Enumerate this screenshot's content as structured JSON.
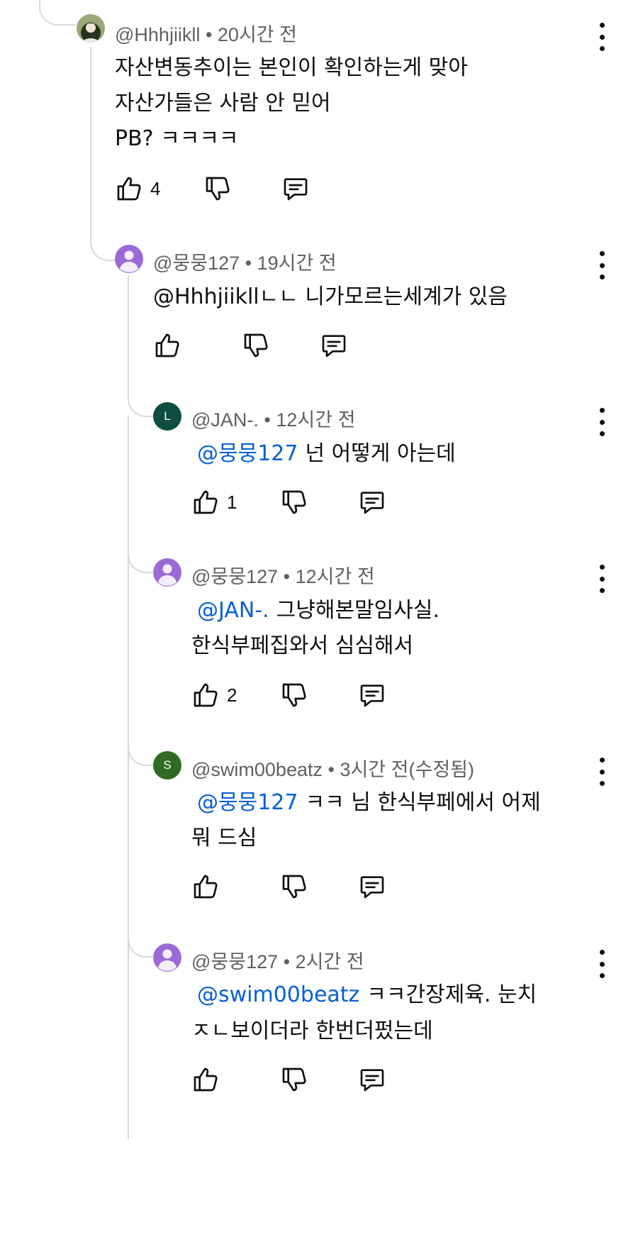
{
  "comments": [
    {
      "author": "@Hhhjiikll",
      "time": "20시간 전",
      "lines": [
        {
          "text": "자산변동추이는 본인이 확인하는게 맞아"
        },
        {
          "text": "자산가들은 사람 안 믿어"
        },
        {
          "text": "PB? ㅋㅋㅋㅋ"
        }
      ],
      "likes": "4",
      "avatar": {
        "type": "photo"
      }
    },
    {
      "author": "@뭉뭉127",
      "time": "19시간 전",
      "lines": [
        {
          "text": "@Hhhjiikllㄴㄴ 니가모르는세계가 있음"
        }
      ],
      "likes": "",
      "avatar": {
        "type": "default",
        "color": "#9c6ad6"
      }
    },
    {
      "author": "@JAN-.",
      "time": "12시간 전",
      "lines": [
        {
          "mention": "@뭉뭉127",
          "text": "넌 어떻게 아는데"
        }
      ],
      "likes": "1",
      "avatar": {
        "type": "letter",
        "letter": "L",
        "color": "#0e4d3f"
      }
    },
    {
      "author": "@뭉뭉127",
      "time": "12시간 전",
      "lines": [
        {
          "mention": "@JAN-.",
          "text": "그냥해본말임사실."
        },
        {
          "text": "한식부페집와서 심심해서"
        }
      ],
      "likes": "2",
      "avatar": {
        "type": "default",
        "color": "#9c6ad6"
      }
    },
    {
      "author": "@swim00beatz",
      "time": "3시간 전(수정됨)",
      "lines": [
        {
          "mention": "@뭉뭉127",
          "text": "ㅋㅋ 님 한식부페에서 어제"
        },
        {
          "text": "뭐 드심"
        }
      ],
      "likes": "",
      "avatar": {
        "type": "letter",
        "letter": "S",
        "color": "#2f6b22"
      }
    },
    {
      "author": "@뭉뭉127",
      "time": "2시간 전",
      "lines": [
        {
          "mention": "@swim00beatz",
          "text": "ㅋㅋ간장제육. 눈치"
        },
        {
          "text": "ㅈㄴ보이더라 한번더펐는데"
        }
      ],
      "likes": "",
      "avatar": {
        "type": "default",
        "color": "#9c6ad6"
      }
    }
  ],
  "icons": {
    "like": "thumb-up-icon",
    "dislike": "thumb-down-icon",
    "reply": "reply-icon",
    "more": "more-vert-icon"
  },
  "colors": {
    "mention": "#065fd4",
    "meta": "#606060",
    "thread_line": "#d9d9d9",
    "text": "#0f0f0f"
  }
}
